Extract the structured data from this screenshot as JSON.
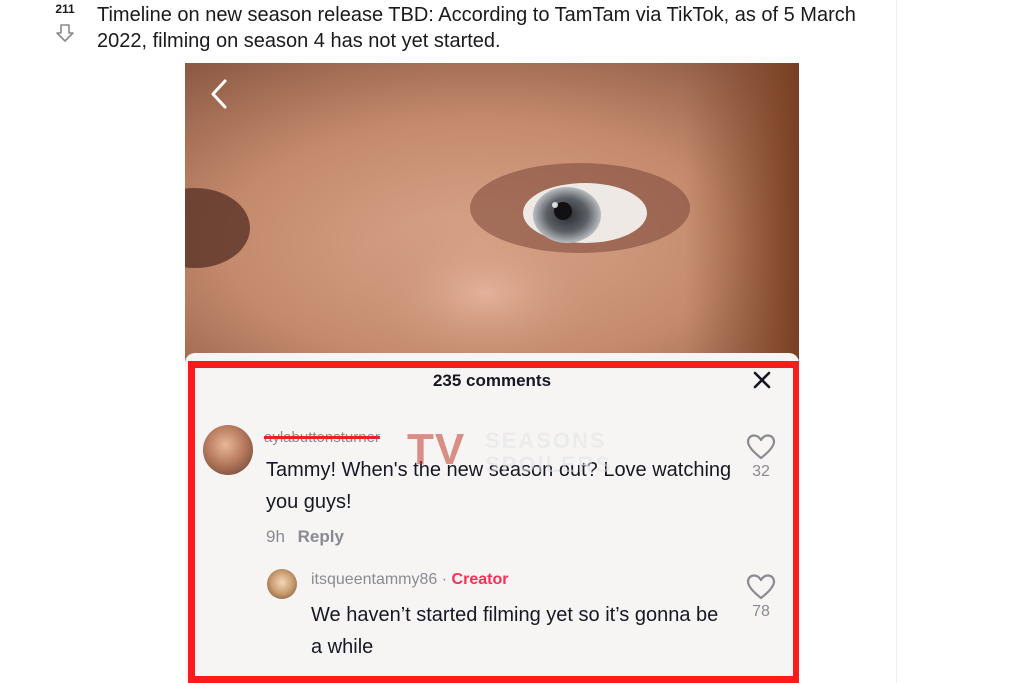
{
  "post": {
    "vote_count": "211",
    "title": "Timeline on new season release TBD: According to TamTam via TikTok, as of 5 March 2022, filming on season 4 has not yet started."
  },
  "tiktok": {
    "comments_header": "235 comments",
    "watermark": {
      "tv": "TV",
      "line1": "SEASONS",
      "line2": "SPOILERS"
    },
    "comments": [
      {
        "username": "aylabuttonsturner",
        "text": "Tammy! When's the new season out? Love watching you guys!",
        "time": "9h",
        "reply_label": "Reply",
        "likes": "32"
      }
    ],
    "reply": {
      "username": "itsqueentammy86",
      "separator": "·",
      "badge": "Creator",
      "text": "We haven’t started filming yet so it’s gonna be a while",
      "likes": "78"
    }
  },
  "colors": {
    "highlight_border": "#ff1a1a",
    "creator_badge": "#fe2c55",
    "muted_text": "#8a8b91"
  },
  "icons": {
    "downvote": "downvote-arrow-icon",
    "back": "chevron-left-icon",
    "close": "close-icon",
    "like": "heart-icon"
  }
}
